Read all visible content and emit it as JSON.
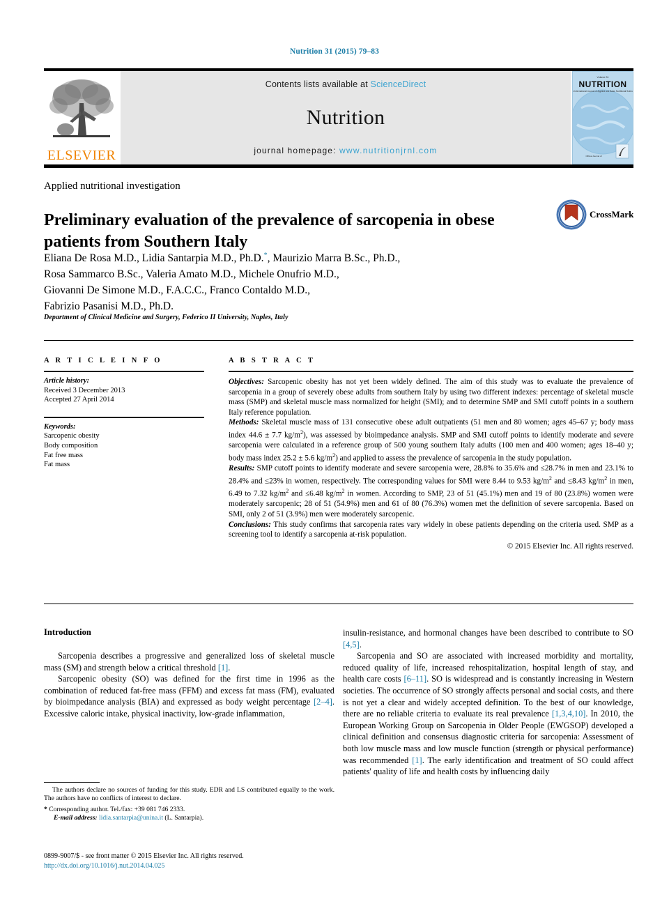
{
  "running_head": "Nutrition 31 (2015) 79–83",
  "masthead": {
    "publisher": "ELSEVIER",
    "contents_prefix": "Contents lists available at ",
    "contents_link": "ScienceDirect",
    "journal_name": "Nutrition",
    "homepage_prefix": "journal homepage: ",
    "homepage_url": "www.nutritionjrnl.com",
    "cover_title": "NUTRITION",
    "cover_kicker": "Volume 31",
    "cover_subtitle": "The International Journal of Applied and Basic Nutritional Sciences",
    "cover_footer": "Official Journal of"
  },
  "section_type": "Applied nutritional investigation",
  "title": "Preliminary evaluation of the prevalence of sarcopenia in obese patients from Southern Italy",
  "crossmark_label": "CrossMark",
  "authors_lines": [
    "Eliana De Rosa M.D., Lidia Santarpia M.D., Ph.D.*, Maurizio Marra B.Sc., Ph.D.,",
    "Rosa Sammarco B.Sc., Valeria Amato M.D., Michele Onufrio M.D.,",
    "Giovanni De Simone M.D., F.A.C.C., Franco Contaldo M.D.,",
    "Fabrizio Pasanisi M.D., Ph.D."
  ],
  "affiliation": "Department of Clinical Medicine and Surgery, Federico II University, Naples, Italy",
  "article_info": {
    "heading": "A R T I C L E  I N F O",
    "history_label": "Article history:",
    "history_lines": [
      "Received 3 December 2013",
      "Accepted 27 April 2014"
    ],
    "keywords_label": "Keywords:",
    "keywords": [
      "Sarcopenic obesity",
      "Body composition",
      "Fat free mass",
      "Fat mass"
    ]
  },
  "abstract": {
    "heading": "A B S T R A C T",
    "objectives_label": "Objectives:",
    "objectives_text": " Sarcopenic obesity has not yet been widely defined. The aim of this study was to evaluate the prevalence of sarcopenia in a group of severely obese adults from southern Italy by using two different indexes: percentage of skeletal muscle mass (SMP) and skeletal muscle mass normalized for height (SMI); and to determine SMP and SMI cutoff points in a southern Italy reference population.",
    "methods_label": "Methods:",
    "methods_text_1": " Skeletal muscle mass of 131 consecutive obese adult outpatients (51 men and 80 women; ages 45–67 y; body mass index 44.6 ± 7.7 kg/m",
    "methods_text_2": "), was assessed by bioimpedance analysis. SMP and SMI cutoff points to identify moderate and severe sarcopenia were calculated in a reference group of 500 young southern Italy adults (100 men and 400 women; ages 18–40 y; body mass index 25.2 ± 5.6 kg/m",
    "methods_text_3": ") and applied to assess the prevalence of sarcopenia in the study population.",
    "results_label": "Results:",
    "results_text_1": " SMP cutoff points to identify moderate and severe sarcopenia were, 28.8% to 35.6% and ≤28.7% in men and 23.1% to 28.4% and ≤23% in women, respectively. The corresponding values for SMI were 8.44 to 9.53 kg/m",
    "results_text_2": " and ≤8.43 kg/m",
    "results_text_3": " in men, 6.49 to 7.32 kg/m",
    "results_text_4": " and ≤6.48 kg/m",
    "results_text_5": " in women. According to SMP, 23 of 51 (45.1%) men and 19 of 80 (23.8%) women were moderately sarcopenic; 28 of 51 (54.9%) men and 61 of 80 (76.3%) women met the definition of severe sarcopenia. Based on SMI, only 2 of 51 (3.9%) men were moderately sarcopenic.",
    "conclusions_label": "Conclusions:",
    "conclusions_text": " This study confirms that sarcopenia rates vary widely in obese patients depending on the criteria used. SMP as a screening tool to identify a sarcopenia at-risk population.",
    "copyright": "© 2015 Elsevier Inc. All rights reserved.",
    "superscript_2": "2"
  },
  "introduction": {
    "heading": "Introduction",
    "left_p1": "Sarcopenia describes a progressive and generalized loss of skeletal muscle mass (SM) and strength below a critical threshold ",
    "left_p1_ref": "[1]",
    "left_p1_end": ".",
    "left_p2_a": "Sarcopenic obesity (SO) was defined for the first time in 1996 as the combination of reduced fat-free mass (FFM) and excess fat mass (FM), evaluated by bioimpedance analysis (BIA) and expressed as body weight percentage ",
    "left_p2_ref": "[2–4]",
    "left_p2_b": ". Excessive caloric intake, physical inactivity, low-grade inflammation,",
    "right_p1_a": "insulin-resistance, and hormonal changes have been described to contribute to SO ",
    "right_p1_ref": "[4,5]",
    "right_p1_b": ".",
    "right_p2_a": "Sarcopenia and SO are associated with increased morbidity and mortality, reduced quality of life, increased rehospitalization, hospital length of stay, and health care costs ",
    "right_p2_ref1": "[6–11]",
    "right_p2_b": ". SO is widespread and is constantly increasing in Western societies. The occurrence of SO strongly affects personal and social costs, and there is not yet a clear and widely accepted definition. To the best of our knowledge, there are no reliable criteria to evaluate its real prevalence ",
    "right_p2_ref2": "[1,3,4,10]",
    "right_p2_c": ". In 2010, the European Working Group on Sarcopenia in Older People (EWGSOP) developed a clinical definition and consensus diagnostic criteria for sarcopenia: Assessment of both low muscle mass and low muscle function (strength or physical performance) was recommended ",
    "right_p2_ref3": "[1]",
    "right_p2_d": ". The early identification and treatment of SO could affect patients' quality of life and health costs by influencing daily"
  },
  "footnotes": {
    "funding": "The authors declare no sources of funding for this study. EDR and LS contributed equally to the work. The authors have no conflicts of interest to declare.",
    "corresponding": "Corresponding author. Tel./fax: +39 081 746 2333.",
    "corresponding_star": "*",
    "email_label": "E-mail address:",
    "email": "lidia.santarpia@unina.it",
    "email_suffix": " (L. Santarpia)."
  },
  "imprint": {
    "issn_line": "0899-9007/$ - see front matter © 2015 Elsevier Inc. All rights reserved.",
    "doi": "http://dx.doi.org/10.1016/j.nut.2014.04.025"
  },
  "colors": {
    "link_blue": "#1f7fa8",
    "light_blue": "#3ba3d0",
    "elsevier_orange": "#F08300",
    "cover_blue": "#bfdcee"
  }
}
